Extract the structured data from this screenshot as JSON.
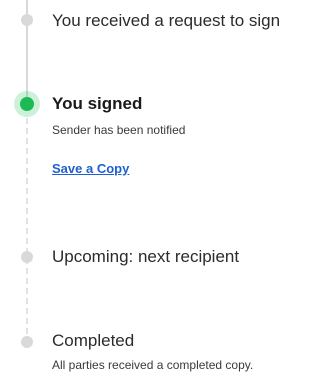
{
  "steps": [
    {
      "title": "You received a request to sign",
      "status": "completed"
    },
    {
      "title": "You signed",
      "subtitle": "Sender has been notified",
      "link_label": "Save a Copy",
      "status": "current"
    },
    {
      "title": "Upcoming: next recipient",
      "status": "upcoming"
    },
    {
      "title": "Completed",
      "subtitle": "All parties received a completed copy.",
      "status": "upcoming"
    }
  ],
  "colors": {
    "active": "#1db954",
    "inactive_dot": "#d9d9d9",
    "link": "#1f5fcf",
    "line": "#d8d8d8"
  }
}
